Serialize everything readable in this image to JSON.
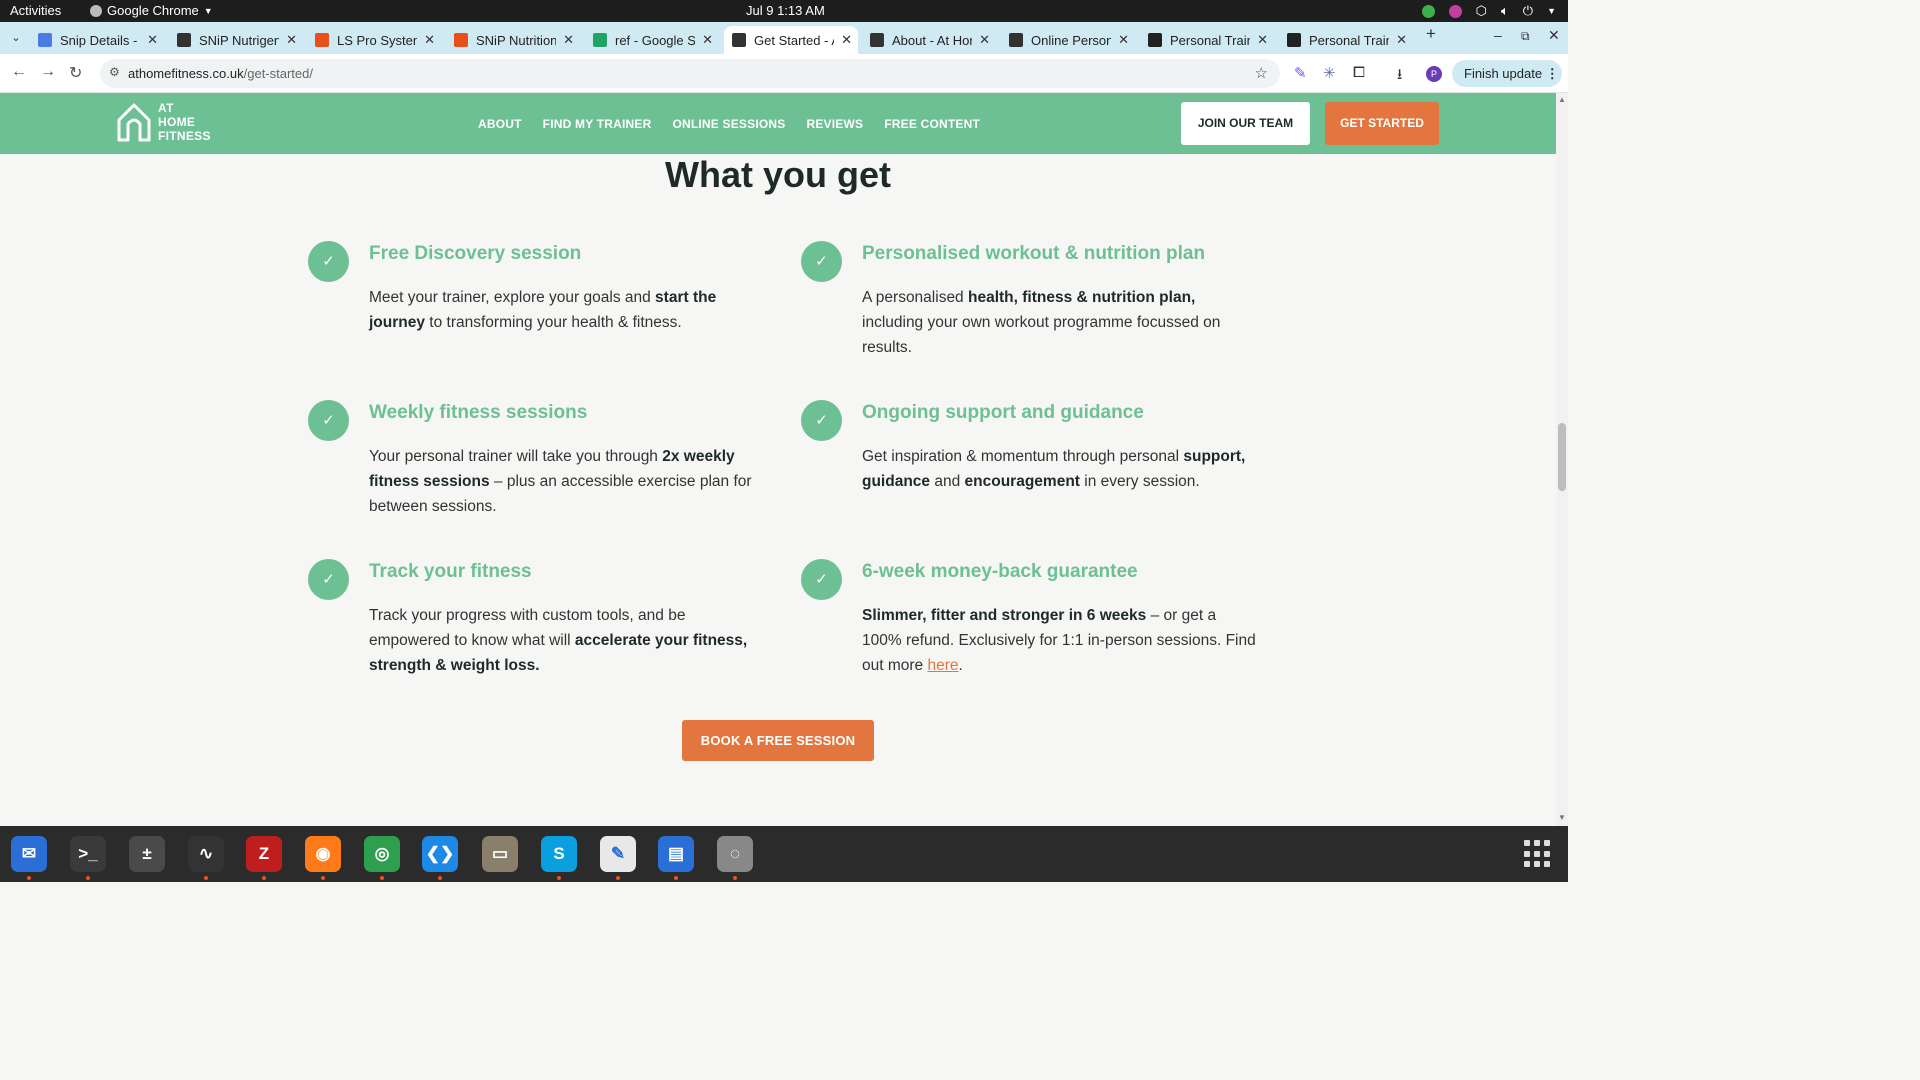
{
  "system": {
    "activities": "Activities",
    "app_name": "Google Chrome",
    "clock": "Jul 9  1:13 AM"
  },
  "tabs": [
    {
      "label": "Snip Details - G",
      "icon": "docs-icon",
      "color": "#4a7ce8"
    },
    {
      "label": "SNiP Nutrigeno",
      "icon": "snip-icon",
      "color": "#333333"
    },
    {
      "label": "LS Pro System",
      "icon": "ls-icon",
      "color": "#e94e1b"
    },
    {
      "label": "SNiP Nutrition",
      "icon": "snip-nutrition-icon",
      "color": "#e94e1b"
    },
    {
      "label": "ref - Google Sh",
      "icon": "sheets-icon",
      "color": "#1fa463"
    },
    {
      "label": "Get Started - A",
      "icon": "athome-icon",
      "color": "#333333",
      "active": true
    },
    {
      "label": "About - At Hom",
      "icon": "athome-icon",
      "color": "#333333"
    },
    {
      "label": "Online Persona",
      "icon": "athome-icon",
      "color": "#333333"
    },
    {
      "label": "Personal Traini",
      "icon": "fs-icon",
      "color": "#222222"
    },
    {
      "label": "Personal Traini",
      "icon": "fs-icon",
      "color": "#222222"
    }
  ],
  "toolbar": {
    "url_domain": "athomefitness.co.uk",
    "url_path": "/get-started/",
    "finish_update": "Finish update",
    "profile_initial": "P"
  },
  "site": {
    "logo_lines": [
      "AT",
      "HOME",
      "FITNESS"
    ],
    "menu": [
      "ABOUT",
      "FIND MY TRAINER",
      "ONLINE SESSIONS",
      "REVIEWS",
      "FREE CONTENT"
    ],
    "join_label": "JOIN OUR TEAM",
    "start_label": "GET STARTED",
    "brand_green": "#6dbf94",
    "brand_orange": "#e3763e"
  },
  "section": {
    "title": "What you get",
    "features": [
      {
        "title": "Free Discovery session",
        "parts": [
          {
            "t": "Meet your trainer, explore your goals and "
          },
          {
            "t": "start the journey",
            "b": true
          },
          {
            "t": " to transforming your health & fitness."
          }
        ]
      },
      {
        "title": "Personalised workout & nutrition plan",
        "parts": [
          {
            "t": "A personalised "
          },
          {
            "t": "health, fitness & nutrition plan,",
            "b": true
          },
          {
            "t": " including  your own workout programme focussed on results."
          }
        ]
      },
      {
        "title": "Weekly fitness sessions",
        "parts": [
          {
            "t": "Your personal trainer will take you through "
          },
          {
            "t": "2x weekly fitness sessions",
            "b": true
          },
          {
            "t": " – plus an accessible exercise plan for between sessions."
          }
        ]
      },
      {
        "title": "Ongoing support and guidance",
        "parts": [
          {
            "t": "Get inspiration & momentum through personal "
          },
          {
            "t": "support, guidance",
            "b": true
          },
          {
            "t": " and "
          },
          {
            "t": "encouragement",
            "b": true
          },
          {
            "t": " in every session."
          }
        ]
      },
      {
        "title": "Track your fitness",
        "parts": [
          {
            "t": "Track your progress with custom tools, and be empowered to know what will "
          },
          {
            "t": "accelerate your fitness, strength & weight loss.",
            "b": true
          }
        ]
      },
      {
        "title": "6-week money-back guarantee",
        "parts": [
          {
            "t": "Slimmer, fitter and stronger in 6 weeks",
            "b": true
          },
          {
            "t": " – or get a 100% refund. Exclusively for 1:1 in-person sessions. Find out more "
          },
          {
            "t": "here",
            "link": true
          },
          {
            "t": "."
          }
        ]
      }
    ],
    "cta": "BOOK A FREE SESSION"
  },
  "dock": [
    {
      "name": "thunderbird-icon",
      "color": "#2a6fd6",
      "glyph": "✉"
    },
    {
      "name": "terminal-icon",
      "color": "#3a3a3a",
      "glyph": ">_"
    },
    {
      "name": "calculator-icon",
      "color": "#4a4a4a",
      "glyph": "±"
    },
    {
      "name": "system-monitor-icon",
      "color": "#333333",
      "glyph": "∿"
    },
    {
      "name": "filezilla-icon",
      "color": "#bf1e1e",
      "glyph": "Z"
    },
    {
      "name": "firefox-icon",
      "color": "#ff7a18",
      "glyph": "◉"
    },
    {
      "name": "chrome-icon",
      "color": "#2e9e4f",
      "glyph": "◎"
    },
    {
      "name": "vscode-icon",
      "color": "#1e88e5",
      "glyph": "❮❯"
    },
    {
      "name": "files-icon",
      "color": "#8a7f6a",
      "glyph": "▭"
    },
    {
      "name": "skype-icon",
      "color": "#0aa0e0",
      "glyph": "S"
    },
    {
      "name": "text-editor-icon",
      "color": "#e8e8e8",
      "glyph": "✎"
    },
    {
      "name": "writer-icon",
      "color": "#2a6fd6",
      "glyph": "▤"
    },
    {
      "name": "disk-icon",
      "color": "#888888",
      "glyph": "◌"
    }
  ]
}
